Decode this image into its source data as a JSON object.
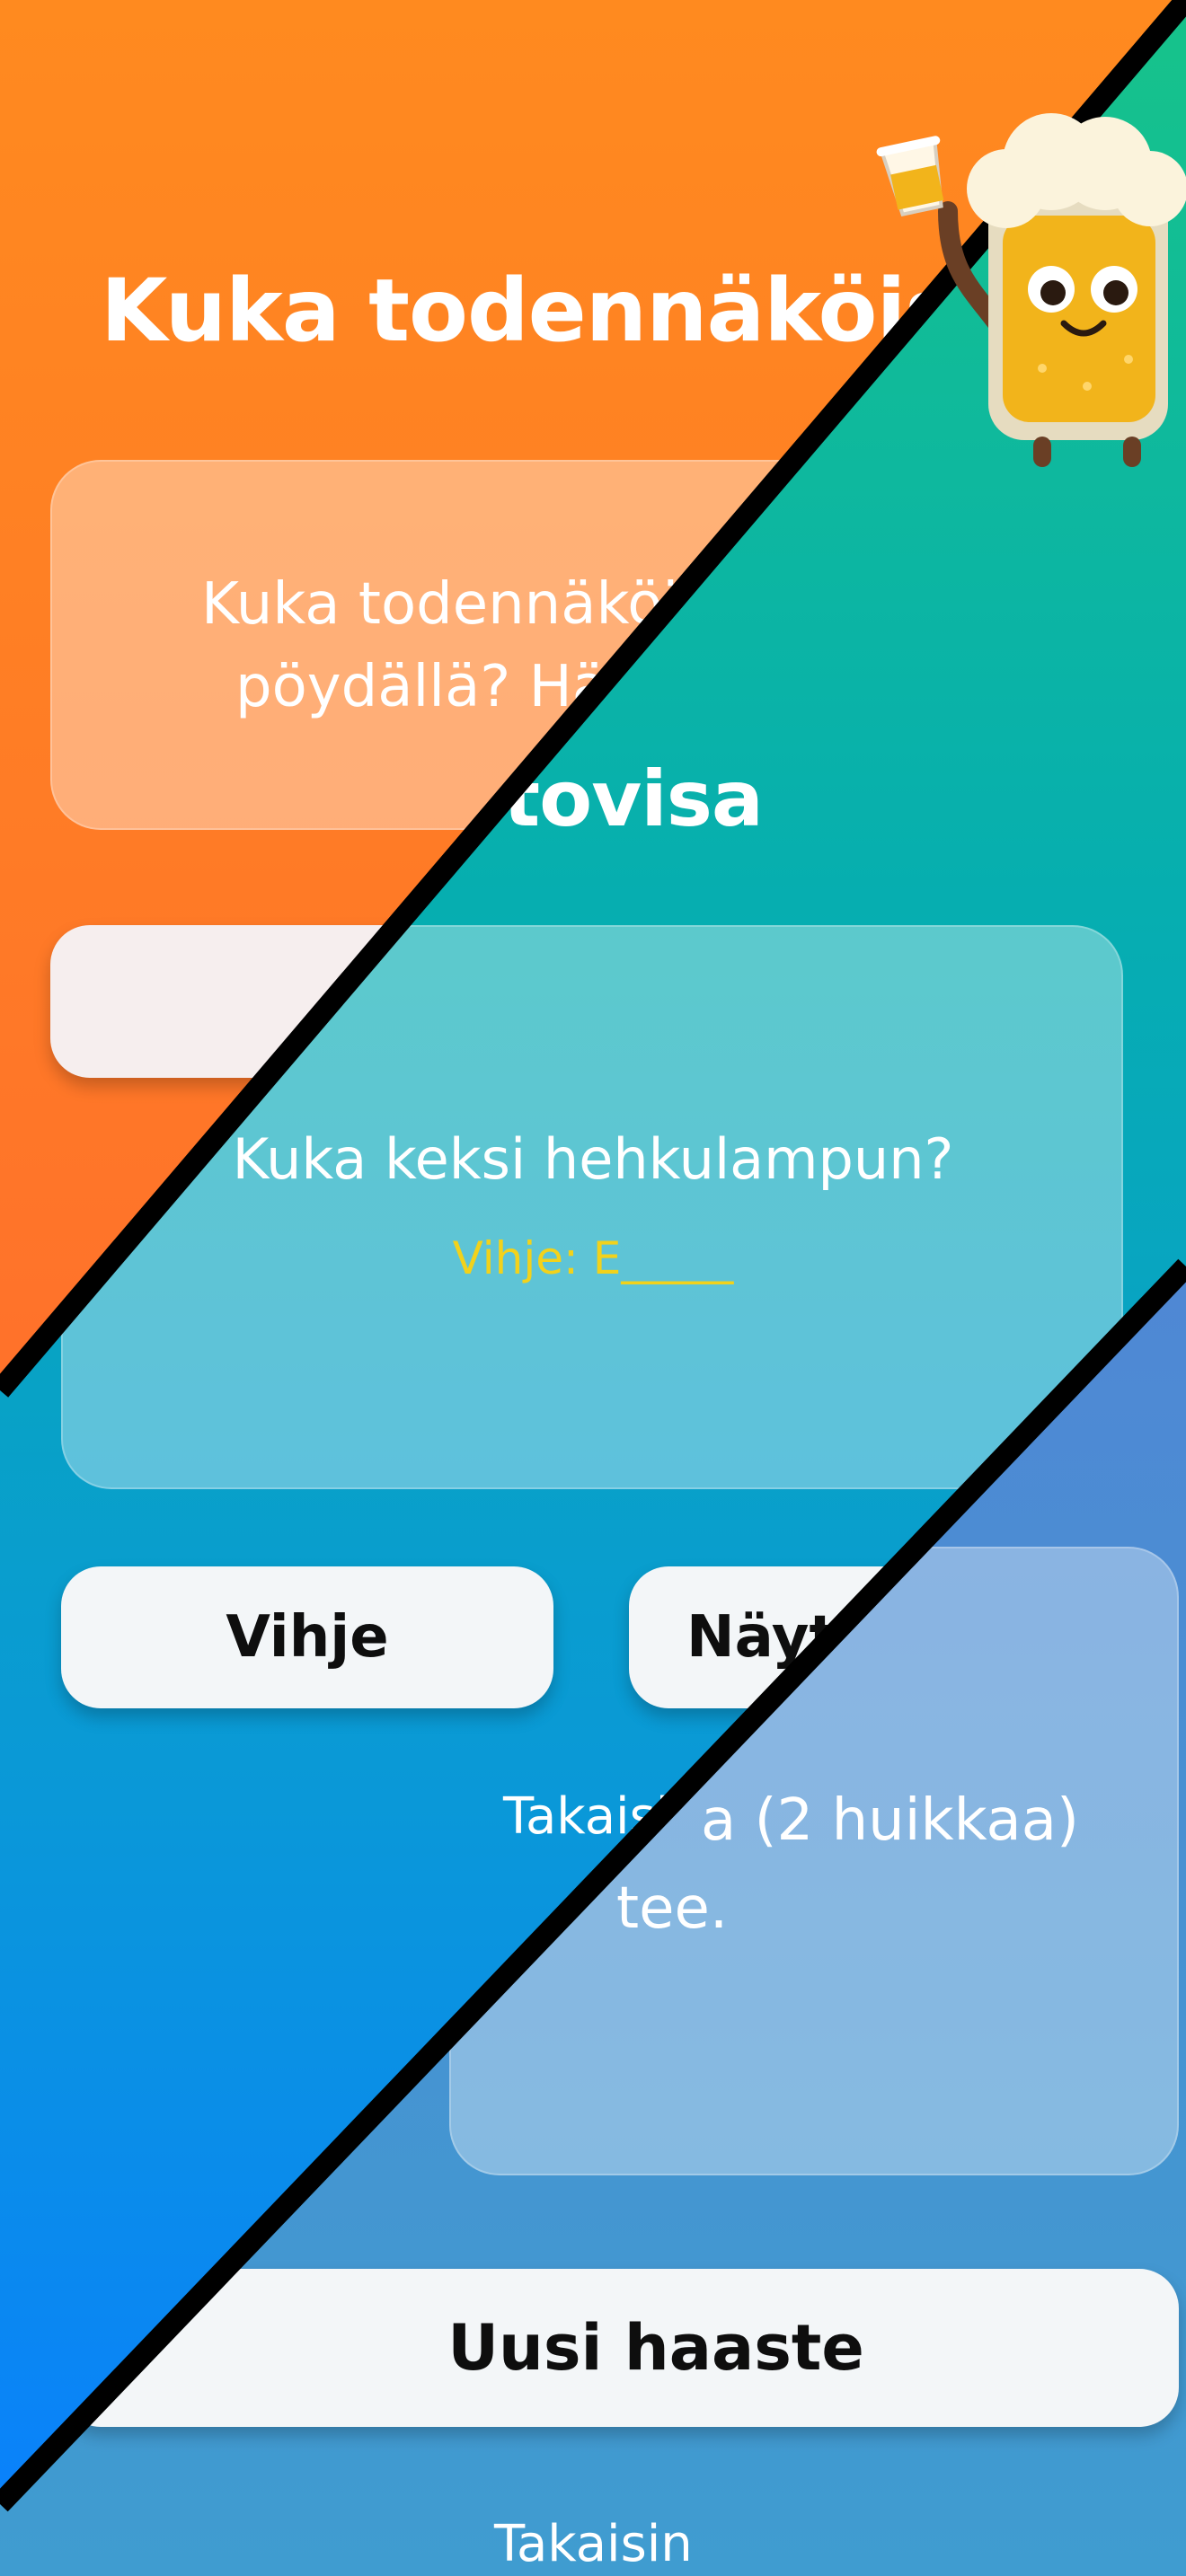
{
  "screens": {
    "screen1": {
      "title": "Kuka todennäköisimmin",
      "card_text_line1": "Kuka todennäköisi",
      "card_text_line2": "pöydällä? Hän"
    },
    "screen2": {
      "title_fragment": "tovisa",
      "question": "Kuka keksi hehkulampun?",
      "hint_text": "Vihje: E_____",
      "hint_button": "Vihje",
      "show_button": "Näytä",
      "back_link": "Takaisin"
    },
    "screen3": {
      "card_line1": "a (2 huikkaa)",
      "card_line2": "tee.",
      "new_challenge_button": "Uusi haaste",
      "back_link": "Takaisin"
    }
  },
  "colors": {
    "orange": "#ff7a24",
    "teal": "#06aeb0",
    "blue": "#4f88d4",
    "hint_yellow": "#f2d21b"
  },
  "icons": {
    "mascot": "beer-mascot-icon"
  }
}
